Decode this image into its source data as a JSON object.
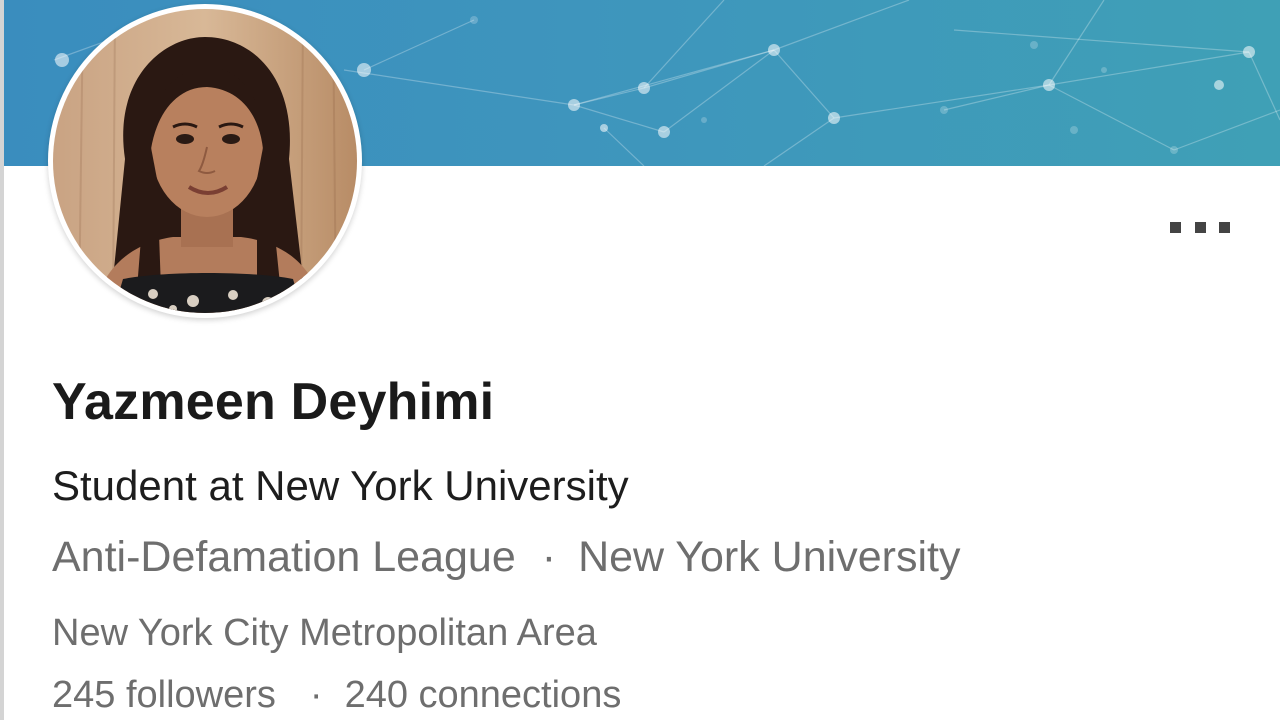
{
  "profile": {
    "name": "Yazmeen Deyhimi",
    "headline": "Student at New York University",
    "affiliations": [
      "Anti-Defamation League",
      "New York University"
    ],
    "separator": "·",
    "location": "New York City Metropolitan Area",
    "followers": "245 followers",
    "connections": "240 connections"
  },
  "icons": {
    "more": "more-options-icon",
    "avatar": "profile-photo"
  },
  "colors": {
    "banner_start": "#3a8dbe",
    "banner_end": "#3fa0b6",
    "primary_text": "#1a1a1a",
    "secondary_text": "#6e6e6e"
  }
}
